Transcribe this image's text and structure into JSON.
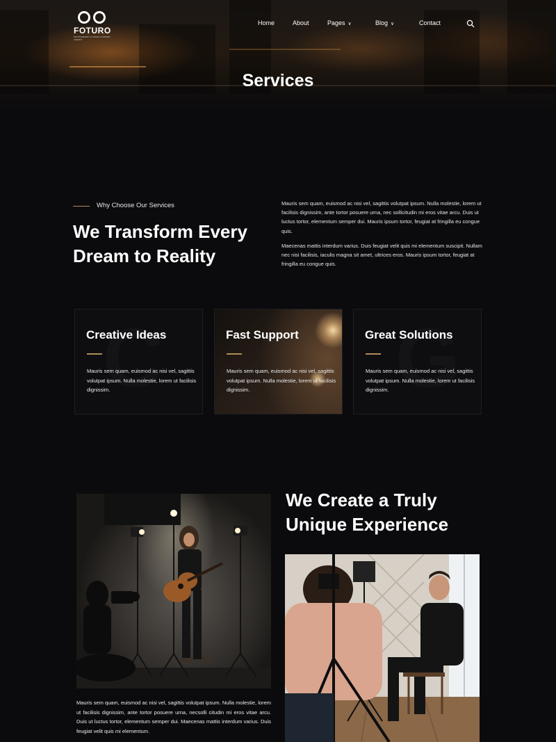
{
  "brand": {
    "name": "FOTURO",
    "tagline": "PHOTOGRAPHY & VISUAL CONTENT AGENCY"
  },
  "nav": {
    "items": [
      {
        "label": "Home",
        "dropdown": false
      },
      {
        "label": "About",
        "dropdown": false
      },
      {
        "label": "Pages",
        "dropdown": true
      },
      {
        "label": "Blog",
        "dropdown": true
      },
      {
        "label": "Contact",
        "dropdown": false
      }
    ],
    "search_icon": "search-icon"
  },
  "hero": {
    "title": "Services"
  },
  "intro": {
    "eyebrow": "Why Choose Our Services",
    "headline": "We Transform Every Dream to Reality",
    "paragraph1": "Mauris sem quam, euismod ac nisi vel, sagittis volutpat ipsum. Nulla molestie, lorem ut facilisis dignissim, ante tortor posuere urna, nec sollicitudin mi eros vitae arcu. Duis ut luctus tortor, elementum semper dui. Mauris ipsum tortor, feugiat at fringilla eu  congue quis.",
    "paragraph2": "Maecenas mattis interdum varius. Duis feugiat velit quis mi elementum suscipit. Nullam nec nisi facilisis, iaculis magna sit amet, ultrices eros. Mauris ipsum tortor, feugiat at fringilla eu  congue quis."
  },
  "cards": [
    {
      "title": "Creative Ideas",
      "text": "Mauris sem quam, euismod ac nisi vel, sagittis volutpat ipsum. Nulla molestie, lorem ut facilisis dignissim."
    },
    {
      "title": "Fast Support",
      "text": "Mauris sem quam, euismod ac nisi vel, sagittis volutpat ipsum. Nulla molestie, lorem ut facilisis dignissim."
    },
    {
      "title": "Great Solutions",
      "text": "Mauris sem quam, euismod ac nisi vel, sagittis volutpat ipsum. Nulla molestie, lorem ut facilisis dignissim."
    }
  ],
  "experience": {
    "title": "We Create a Truly Unique Experience",
    "paragraph": "Mauris sem quam, euismod ac nisi vel, sagittis volutpat ipsum. Nulla molestie, lorem ut facilisis dignissim, ante tortor posuere urna, necsolli citudin mi eros vitae arcu. Duis ut luctus tortor, elementum semper dui. Maecenas mattis interdum varius. Duis feugiat velit quis mi elementum."
  },
  "colors": {
    "background": "#0b0b0d",
    "accent": "#b08d57",
    "card": "#0e0e10"
  }
}
